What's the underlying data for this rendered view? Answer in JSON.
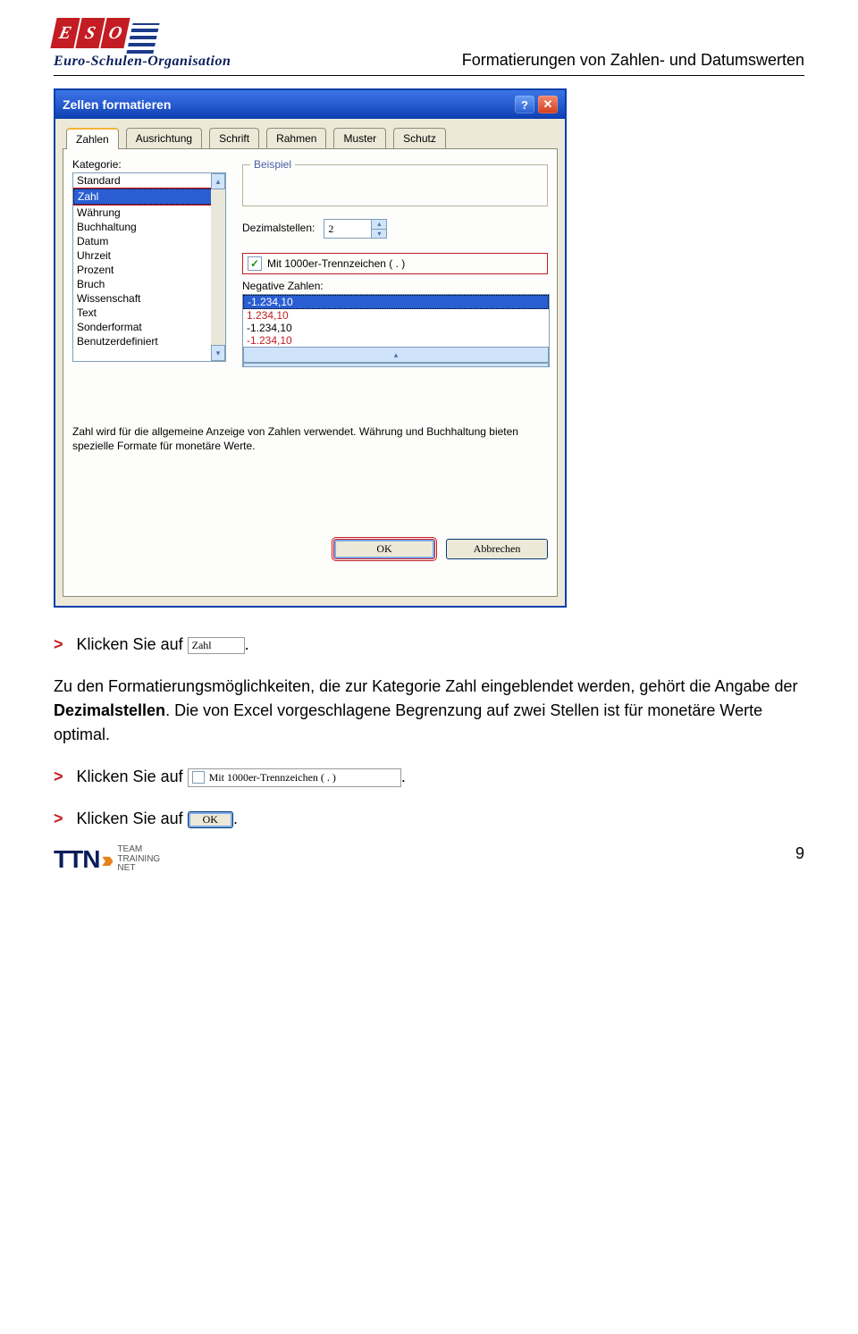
{
  "header": {
    "brand_letters": [
      "E",
      "S",
      "O"
    ],
    "brand_line": "Euro-Schulen-Organisation",
    "doc_title": "Formatierungen von Zahlen- und Datumswerten"
  },
  "dialog": {
    "title": "Zellen formatieren",
    "tabs": [
      "Zahlen",
      "Ausrichtung",
      "Schrift",
      "Rahmen",
      "Muster",
      "Schutz"
    ],
    "active_tab": 0,
    "kategorie_label": "Kategorie:",
    "kategorien": [
      "Standard",
      "Zahl",
      "Währung",
      "Buchhaltung",
      "Datum",
      "Uhrzeit",
      "Prozent",
      "Bruch",
      "Wissenschaft",
      "Text",
      "Sonderformat",
      "Benutzerdefiniert"
    ],
    "kategorie_selected": 1,
    "beispiel_legend": "Beispiel",
    "dezimal_label": "Dezimalstellen:",
    "dezimal_value": "2",
    "chk_label": "Mit 1000er-Trennzeichen ( . )",
    "chk_checked": true,
    "neg_label": "Negative Zahlen:",
    "neg_items": [
      {
        "text": "-1.234,10",
        "sel": true,
        "red": false
      },
      {
        "text": "1.234,10",
        "sel": false,
        "red": true
      },
      {
        "text": "-1.234,10",
        "sel": false,
        "red": false
      },
      {
        "text": "-1.234,10",
        "sel": false,
        "red": true
      }
    ],
    "desc": "Zahl wird für die allgemeine Anzeige von Zahlen verwendet. Währung und Buchhaltung bieten spezielle Formate für monetäre Werte.",
    "ok": "OK",
    "cancel": "Abbrechen"
  },
  "instructions": {
    "line1_pre": "Klicken Sie auf",
    "line1_img": "Zahl",
    "line1_post": ".",
    "para": "Zu den Formatierungsmöglichkeiten, die zur Kategorie Zahl eingeblendet werden, gehört die Angabe der ",
    "para_bold": "Dezimalstellen",
    "para2": ". Die von Excel vorgeschlagene Begrenzung auf zwei Stellen ist für monetäre Werte optimal.",
    "line2_pre": "Klicken Sie auf",
    "line2_chk": "Mit 1000er-Trennzeichen ( . )",
    "line2_post": ".",
    "line3_pre": "Klicken Sie auf",
    "line3_ok": "OK",
    "line3_post": "."
  },
  "footer": {
    "page": "9",
    "ttn_line1": "TEAM",
    "ttn_line2": "TRAINING",
    "ttn_line3": "NET"
  }
}
